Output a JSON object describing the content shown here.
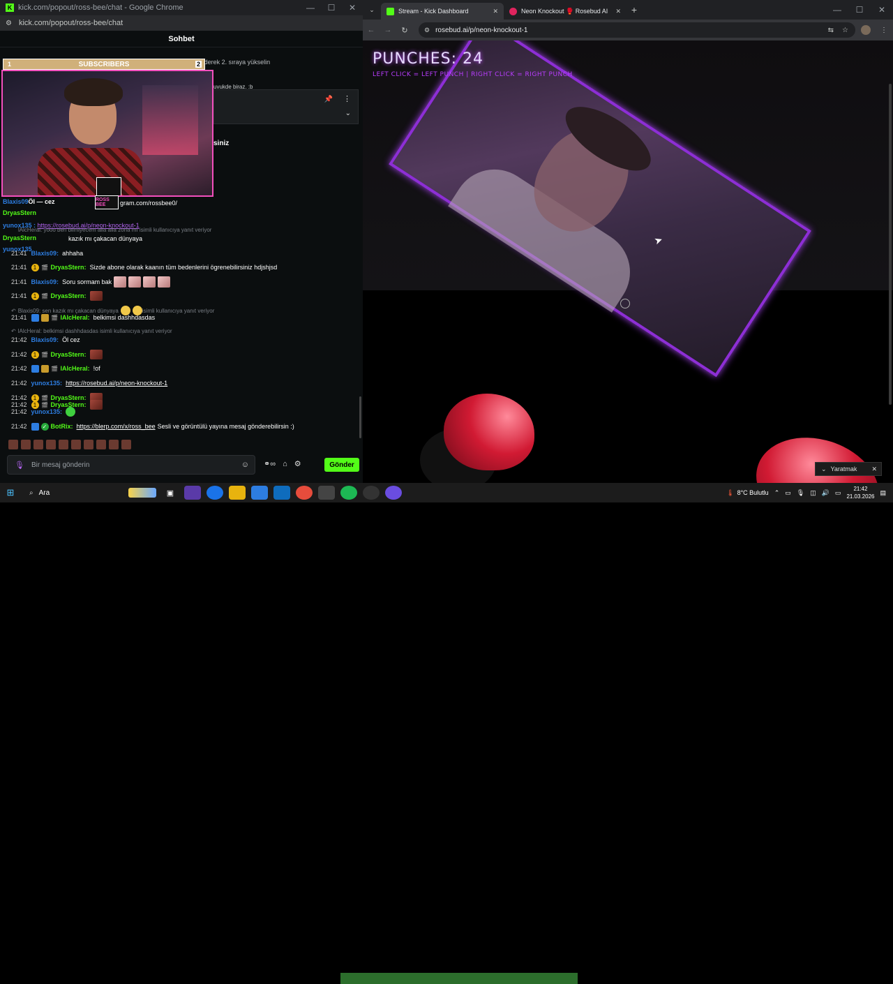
{
  "left_window": {
    "title": "kick.com/popout/ross-bee/chat - Google Chrome",
    "url": "kick.com/popout/ross-bee/chat",
    "controls": {
      "minimize": "—",
      "maximize": "☐",
      "close": "✕"
    }
  },
  "chat": {
    "header": "Sohbet",
    "gift_notice": "1 abonelik hediye ederek 2. sıraya yükselin",
    "pinned_preview": "uvukde biraz. :b",
    "partial_text": "siniz",
    "subscribers_bar": {
      "label": "SUBSCRIBERS",
      "left_num": "1",
      "right_num": "2"
    },
    "webcam_logo": "ROSS BEE",
    "overlay_lines": [
      {
        "user": "Blaxis09",
        "text": "Öl — cez"
      },
      {
        "user": "DryasStern",
        "text": ""
      },
      {
        "user": "yunox135",
        "text": "https://rosebud.ai/p/neon-knockout-1"
      },
      {
        "user": "DryasStern",
        "text": ""
      },
      {
        "user": "yunox135",
        "text": ""
      }
    ],
    "overlay_reply": "lAlcHeral: yooo ben bilmiyecem alla alla zorla mı isimli kullanıcıya yanıt veriyor",
    "overlay_instagram": "gram.com/rossbee0/",
    "overlay_kaz": "kazık mı çakacan dünyaya",
    "messages": [
      {
        "time": "21:41",
        "user": "Blaxis09",
        "user_color": "#2d7de1",
        "text": "ahhaha",
        "badges": []
      },
      {
        "time": "21:41",
        "user": "DryasStern",
        "user_color": "#53fc18",
        "text": "Sizde abone olarak kaanın tüm bedenlerini ögrenebilirsiniz hdjshjsd",
        "badges": [
          "yellow",
          "clap"
        ]
      },
      {
        "time": "21:41",
        "user": "Blaxis09",
        "user_color": "#2d7de1",
        "text": "Soru sormam bak",
        "badges": []
      },
      {
        "time": "21:41",
        "user": "DryasStern",
        "user_color": "#53fc18",
        "text": "",
        "badges": [
          "yellow",
          "clap"
        ]
      },
      {
        "time": "21:41",
        "user": "lAlcHeral",
        "user_color": "#53fc18",
        "text": "belkimsi dashhdasdas",
        "badges": [
          "blue",
          "gold",
          "clap"
        ]
      },
      {
        "time": "21:42",
        "user": "Blaxis09",
        "user_color": "#2d7de1",
        "text": "Öl   cez",
        "badges": []
      },
      {
        "time": "21:42",
        "user": "DryasStern",
        "user_color": "#53fc18",
        "text": "",
        "badges": [
          "yellow",
          "clap"
        ]
      },
      {
        "time": "21:42",
        "user": "lAlcHeral",
        "user_color": "#53fc18",
        "text": "!of",
        "badges": [
          "blue",
          "gold",
          "clap"
        ]
      },
      {
        "time": "21:42",
        "user": "yunox135",
        "user_color": "#2d7de1",
        "link": "https://rosebud.ai/p/neon-knockout-1",
        "badges": []
      },
      {
        "time": "21:42",
        "user": "DryasStern",
        "user_color": "#53fc18",
        "text": "",
        "badges": [
          "yellow",
          "clap"
        ]
      },
      {
        "time": "21:42",
        "user": "DryasStern",
        "user_color": "#53fc18",
        "text": "",
        "badges": [
          "yellow",
          "clap"
        ]
      },
      {
        "time": "21:42",
        "user": "yunox135",
        "user_color": "#2d7de1",
        "text": "",
        "badges": []
      },
      {
        "time": "21:42",
        "user": "BotRix",
        "user_color": "#53fc18",
        "link": "https://blerp.com/x/ross_bee",
        "text": "Sesli ve görüntülü yayına mesaj gönderebilirsin :)",
        "badges": [
          "blue",
          "green"
        ]
      }
    ],
    "replies": [
      "Blaxis09: sen kazık mı çakacan dünyaya",
      "isimli kullanıcıya yanıt veriyor",
      "lAlcHeral: belkimsi dashhdasdas isimli kullanıcıya yanıt veriyor"
    ],
    "input_placeholder": "Bir mesaj gönderin",
    "send_label": "Gönder"
  },
  "right_window": {
    "tabs": [
      {
        "label": "Stream - Kick Dashboard",
        "active": true,
        "favicon_color": "#53fc18"
      },
      {
        "label": "Neon Knockout 🥊 Rosebud AI",
        "active": false,
        "favicon_color": "#e0245e"
      }
    ],
    "url": "rosebud.ai/p/neon-knockout-1",
    "controls": {
      "minimize": "—",
      "maximize": "☐",
      "close": "✕"
    }
  },
  "game": {
    "score_label": "PUNCHES: 24",
    "hint": "LEFT CLICK = LEFT PUNCH | RIGHT CLICK = RIGHT PUNCH",
    "punches": 24
  },
  "popup": {
    "label": "Yaratmak"
  },
  "taskbar": {
    "search_label": "Ara",
    "weather": "8°C  Bulutlu",
    "time": "21:42",
    "date": "21.03.2026"
  },
  "colors": {
    "kick_green": "#53fc18",
    "neon_purple": "#b93dff",
    "badge_blue": "#2d7de1"
  }
}
